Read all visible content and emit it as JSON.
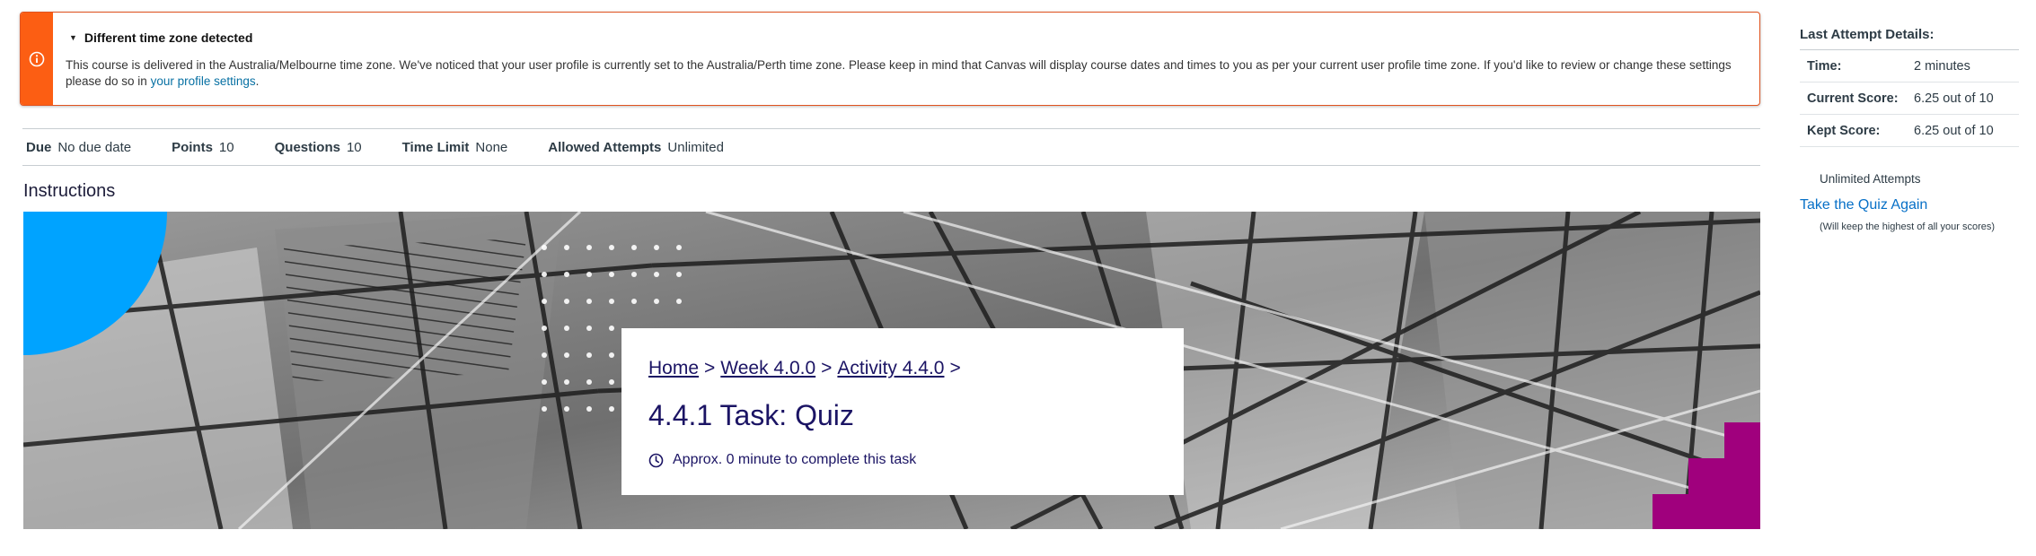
{
  "alert": {
    "title": "Different time zone detected",
    "body_text": "This course is delivered in the Australia/Melbourne time zone. We've noticed that your user profile is currently set to the Australia/Perth time zone. Please keep in mind that Canvas will display course dates and times to you as per your current user profile time zone. If you'd like to review or change these settings please do so in ",
    "link_text": "your profile settings",
    "end_text": ".",
    "icon": "info-icon",
    "accent_color": "#fc5e13"
  },
  "quiz_info": {
    "due_label": "Due",
    "due_value": "No due date",
    "points_label": "Points",
    "points_value": "10",
    "questions_label": "Questions",
    "questions_value": "10",
    "time_limit_label": "Time Limit",
    "time_limit_value": "None",
    "attempts_label": "Allowed Attempts",
    "attempts_value": "Unlimited"
  },
  "instructions": {
    "title": "Instructions"
  },
  "banner": {
    "crumb_home": "Home",
    "crumb_week": "Week 4.0.0",
    "crumb_activity": "Activity 4.4.0",
    "separator": ">",
    "task_title": "4.4.1 Task: Quiz",
    "duration_text": "Approx. 0 minute to complete this task",
    "duration_icon": "clock-icon",
    "corner_color_blue": "#00a3ff",
    "corner_color_magenta": "#a0007d"
  },
  "sidebar": {
    "title": "Last Attempt Details:",
    "time_label": "Time:",
    "time_value": "2 minutes",
    "current_score_label": "Current Score:",
    "current_score_value": "6.25 out of 10",
    "kept_score_label": "Kept Score:",
    "kept_score_value": "6.25 out of 10",
    "unlimited_text": "Unlimited Attempts",
    "take_again_text": "Take the Quiz Again",
    "keep_note": "(Will keep the highest of all your scores)",
    "link_color": "#0770c7"
  }
}
